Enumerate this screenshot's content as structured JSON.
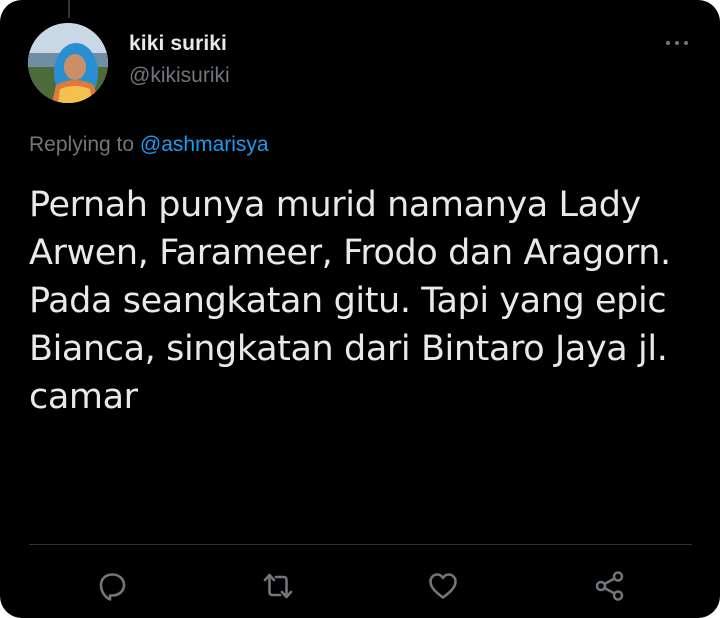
{
  "tweet": {
    "author": {
      "display_name": "kiki suriki",
      "handle": "@kikisuriki"
    },
    "replying_to": {
      "prefix": "Replying to",
      "handle": "@ashmarisya"
    },
    "text_lines": [
      "Pernah punya murid namanya Lady",
      "Arwen, Farameer, Frodo dan Aragorn.",
      "Pada seangkatan gitu. Tapi yang epic",
      "Bianca, singkatan dari Bintaro Jaya jl.",
      "camar"
    ],
    "actions": [
      {
        "name": "reply",
        "icon": "reply-icon"
      },
      {
        "name": "retweet",
        "icon": "retweet-icon"
      },
      {
        "name": "like",
        "icon": "heart-icon"
      },
      {
        "name": "share",
        "icon": "share-icon"
      }
    ]
  },
  "colors": {
    "background": "#000000",
    "text_primary": "#e7e9ea",
    "text_secondary": "#71767b",
    "link": "#1d9bf0",
    "divider": "#2f3336"
  }
}
